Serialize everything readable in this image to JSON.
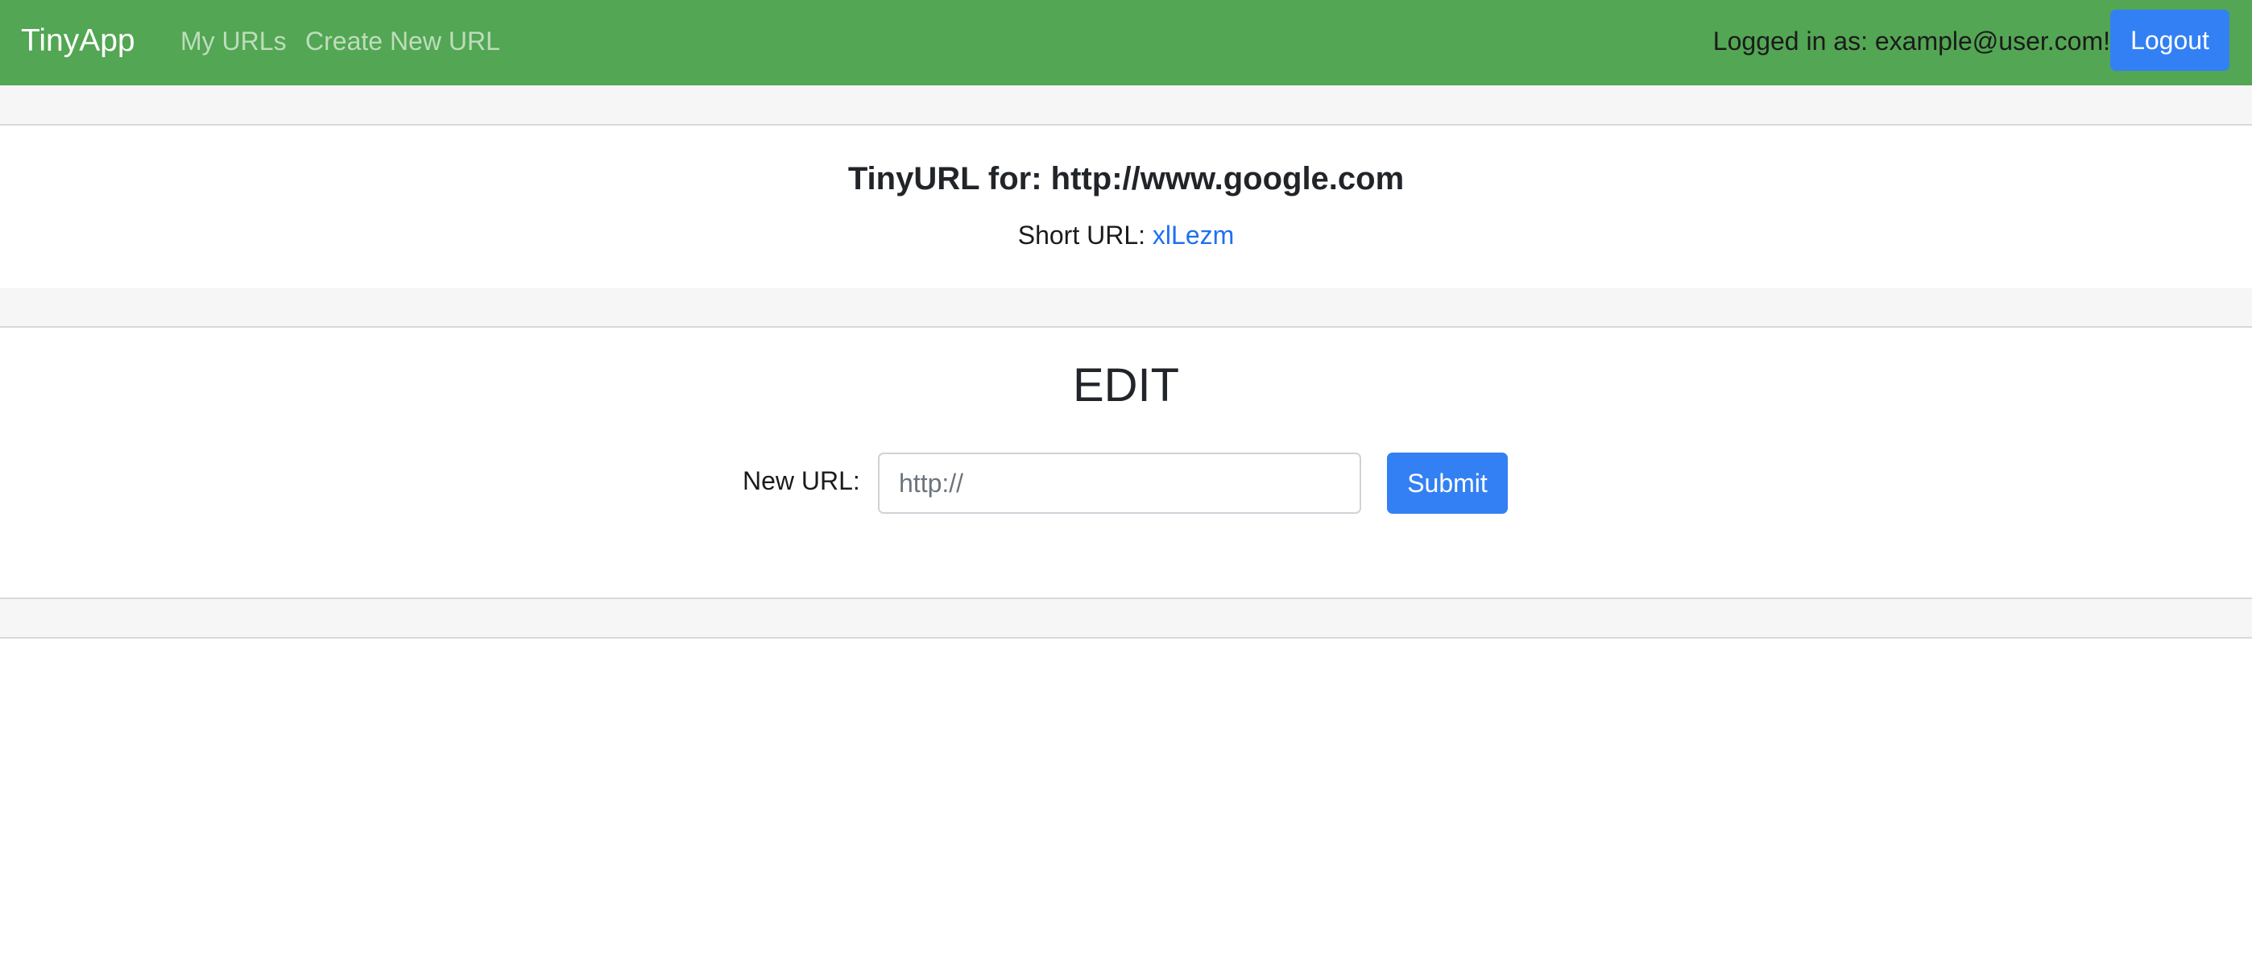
{
  "navbar": {
    "brand": "TinyApp",
    "links": [
      {
        "label": "My URLs"
      },
      {
        "label": "Create New URL"
      }
    ],
    "login_status": "Logged in as: example@user.com!",
    "logout_label": "Logout"
  },
  "url_info": {
    "title": "TinyURL for: http://www.google.com",
    "short_url_label": "Short URL: ",
    "short_url_value": "xlLezm"
  },
  "edit": {
    "title": "EDIT",
    "field_label": "New URL:",
    "field_value": "",
    "field_placeholder": "http://",
    "submit_label": "Submit"
  },
  "colors": {
    "navbar_bg": "#53a653",
    "button_bg": "#3380f5",
    "link": "#1f6ff0"
  }
}
